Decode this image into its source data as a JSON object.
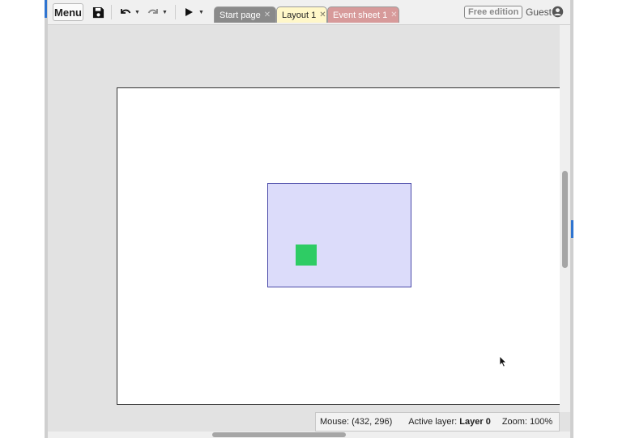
{
  "toolbar": {
    "menu_label": "Menu",
    "icons": [
      "save-icon",
      "undo-icon",
      "redo-icon",
      "play-icon"
    ]
  },
  "tabs": [
    {
      "label": "Start page",
      "color": "#8a8a8a"
    },
    {
      "label": "Layout 1",
      "color": "#fff7c9",
      "active": true
    },
    {
      "label": "Event sheet 1",
      "color": "#d79a9a"
    }
  ],
  "account": {
    "edition": "Free edition",
    "user": "Guest"
  },
  "status": {
    "mouse_label": "Mouse:",
    "mouse_value": "(432, 296)",
    "layer_label": "Active layer:",
    "layer_value": "Layer 0",
    "zoom_label": "Zoom:",
    "zoom_value": "100%"
  },
  "colors": {
    "accent": "#2f74d0",
    "sprite": "#2ecc64",
    "layer_region": "#dcdcfa"
  }
}
